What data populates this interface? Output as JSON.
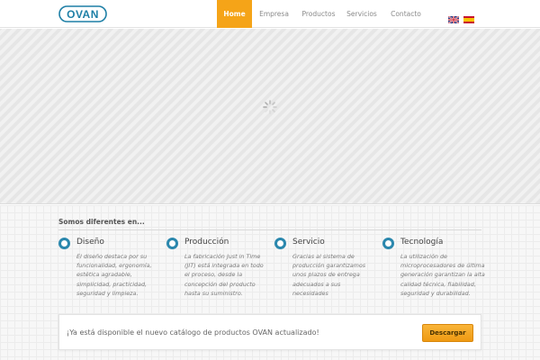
{
  "header": {
    "logo_text": "OVAN",
    "nav": [
      {
        "label": "Home",
        "active": true
      },
      {
        "label": "Empresa",
        "active": false
      },
      {
        "label": "Productos",
        "active": false
      },
      {
        "label": "Servicios",
        "active": false
      },
      {
        "label": "Contacto",
        "active": false
      }
    ],
    "languages": [
      "english-flag-icon",
      "spanish-flag-icon"
    ]
  },
  "slider": {
    "state": "loading",
    "icon": "loading-spinner-icon"
  },
  "features_section": {
    "title": "Somos diferentes en...",
    "items": [
      {
        "icon": "circle-icon",
        "title": "Diseño",
        "text": "El diseño destaca por su funcionalidad, ergonomía, estética agradable, simplicidad, practicidad, seguridad y limpieza."
      },
      {
        "icon": "circle-icon",
        "title": "Producción",
        "text": "La fabricación Just in Time (JIT) está integrada en todo el proceso, desde la concepción del producto hasta su suministro."
      },
      {
        "icon": "circle-icon",
        "title": "Servicio",
        "text": "Gracias al sistema de producción garantizamos unos plazos de entrega adecuados a sus necesidades"
      },
      {
        "icon": "circle-icon",
        "title": "Tecnología",
        "text": "La utilización de microprocesadores de última generación garantizan la alta calidad técnica, fiabilidad, seguridad y durabilidad."
      }
    ]
  },
  "callout": {
    "text": "¡Ya está disponible el nuevo catálogo de productos OVAN actualizado!",
    "button_label": "Descargar"
  },
  "colors": {
    "accent": "#f5a418",
    "feature_icon": "#2a87ad",
    "logo": "#1d7fa6"
  }
}
